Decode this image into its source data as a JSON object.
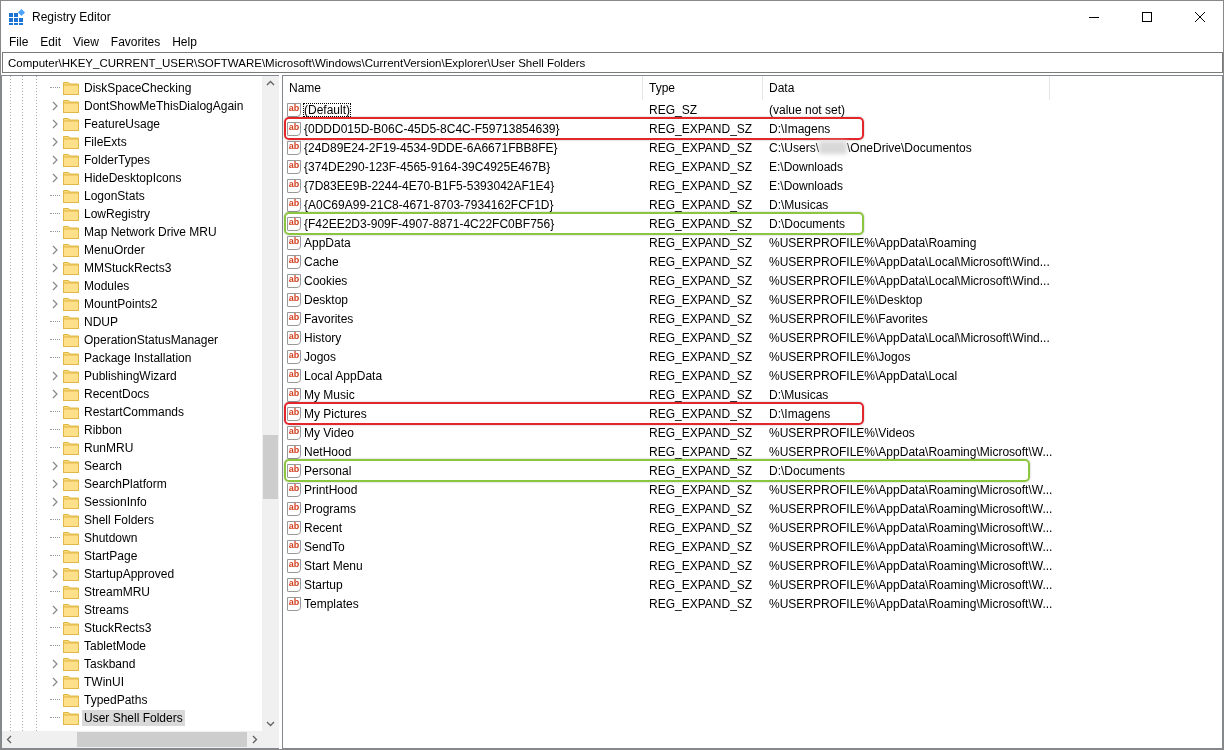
{
  "window": {
    "title": "Registry Editor"
  },
  "menu": [
    "File",
    "Edit",
    "View",
    "Favorites",
    "Help"
  ],
  "address": "Computer\\HKEY_CURRENT_USER\\SOFTWARE\\Microsoft\\Windows\\CurrentVersion\\Explorer\\User Shell Folders",
  "tree": {
    "items": [
      {
        "label": "DiskSpaceChecking",
        "expandable": false,
        "selected": false
      },
      {
        "label": "DontShowMeThisDialogAgain",
        "expandable": true,
        "selected": false
      },
      {
        "label": "FeatureUsage",
        "expandable": true,
        "selected": false
      },
      {
        "label": "FileExts",
        "expandable": true,
        "selected": false
      },
      {
        "label": "FolderTypes",
        "expandable": true,
        "selected": false
      },
      {
        "label": "HideDesktopIcons",
        "expandable": true,
        "selected": false
      },
      {
        "label": "LogonStats",
        "expandable": false,
        "selected": false
      },
      {
        "label": "LowRegistry",
        "expandable": false,
        "selected": false
      },
      {
        "label": "Map Network Drive MRU",
        "expandable": false,
        "selected": false
      },
      {
        "label": "MenuOrder",
        "expandable": true,
        "selected": false
      },
      {
        "label": "MMStuckRects3",
        "expandable": true,
        "selected": false
      },
      {
        "label": "Modules",
        "expandable": true,
        "selected": false
      },
      {
        "label": "MountPoints2",
        "expandable": true,
        "selected": false
      },
      {
        "label": "NDUP",
        "expandable": false,
        "selected": false
      },
      {
        "label": "OperationStatusManager",
        "expandable": false,
        "selected": false
      },
      {
        "label": "Package Installation",
        "expandable": false,
        "selected": false
      },
      {
        "label": "PublishingWizard",
        "expandable": true,
        "selected": false
      },
      {
        "label": "RecentDocs",
        "expandable": true,
        "selected": false
      },
      {
        "label": "RestartCommands",
        "expandable": false,
        "selected": false
      },
      {
        "label": "Ribbon",
        "expandable": false,
        "selected": false
      },
      {
        "label": "RunMRU",
        "expandable": false,
        "selected": false
      },
      {
        "label": "Search",
        "expandable": true,
        "selected": false
      },
      {
        "label": "SearchPlatform",
        "expandable": true,
        "selected": false
      },
      {
        "label": "SessionInfo",
        "expandable": true,
        "selected": false
      },
      {
        "label": "Shell Folders",
        "expandable": false,
        "selected": false
      },
      {
        "label": "Shutdown",
        "expandable": false,
        "selected": false
      },
      {
        "label": "StartPage",
        "expandable": false,
        "selected": false
      },
      {
        "label": "StartupApproved",
        "expandable": true,
        "selected": false
      },
      {
        "label": "StreamMRU",
        "expandable": false,
        "selected": false
      },
      {
        "label": "Streams",
        "expandable": true,
        "selected": false
      },
      {
        "label": "StuckRects3",
        "expandable": false,
        "selected": false
      },
      {
        "label": "TabletMode",
        "expandable": false,
        "selected": false
      },
      {
        "label": "Taskband",
        "expandable": true,
        "selected": false
      },
      {
        "label": "TWinUI",
        "expandable": true,
        "selected": false
      },
      {
        "label": "TypedPaths",
        "expandable": false,
        "selected": false
      },
      {
        "label": "User Shell Folders",
        "expandable": false,
        "selected": true
      }
    ]
  },
  "table": {
    "columns": [
      "Name",
      "Type",
      "Data"
    ],
    "rows": [
      {
        "icon": "ab",
        "name": "(Default)",
        "type": "REG_SZ",
        "data": "(value not set)",
        "focused": true
      },
      {
        "icon": "ab",
        "name": "{0DDD015D-B06C-45D5-8C4C-F59713854639}",
        "type": "REG_EXPAND_SZ",
        "data": "D:\\Imagens",
        "color": "#e3262b"
      },
      {
        "icon": "ab",
        "name": "{24D89E24-2F19-4534-9DDE-6A6671FBB8FE}",
        "type": "REG_EXPAND_SZ",
        "data": "C:\\Users\\",
        "redacted": true,
        "data_after": "\\OneDrive\\Documentos"
      },
      {
        "icon": "ab",
        "name": "{374DE290-123F-4565-9164-39C4925E467B}",
        "type": "REG_EXPAND_SZ",
        "data": "E:\\Downloads"
      },
      {
        "icon": "ab",
        "name": "{7D83EE9B-2244-4E70-B1F5-5393042AF1E4}",
        "type": "REG_EXPAND_SZ",
        "data": "E:\\Downloads"
      },
      {
        "icon": "ab",
        "name": "{A0C69A99-21C8-4671-8703-7934162FCF1D}",
        "type": "REG_EXPAND_SZ",
        "data": "D:\\Musicas"
      },
      {
        "icon": "ab",
        "name": "{F42EE2D3-909F-4907-8871-4C22FC0BF756}",
        "type": "REG_EXPAND_SZ",
        "data": "D:\\Documents",
        "color": "#8cc63f"
      },
      {
        "icon": "ab",
        "name": "AppData",
        "type": "REG_EXPAND_SZ",
        "data": "%USERPROFILE%\\AppData\\Roaming"
      },
      {
        "icon": "ab",
        "name": "Cache",
        "type": "REG_EXPAND_SZ",
        "data": "%USERPROFILE%\\AppData\\Local\\Microsoft\\Wind..."
      },
      {
        "icon": "ab",
        "name": "Cookies",
        "type": "REG_EXPAND_SZ",
        "data": "%USERPROFILE%\\AppData\\Local\\Microsoft\\Wind..."
      },
      {
        "icon": "ab",
        "name": "Desktop",
        "type": "REG_EXPAND_SZ",
        "data": "%USERPROFILE%\\Desktop"
      },
      {
        "icon": "ab",
        "name": "Favorites",
        "type": "REG_EXPAND_SZ",
        "data": "%USERPROFILE%\\Favorites"
      },
      {
        "icon": "ab",
        "name": "History",
        "type": "REG_EXPAND_SZ",
        "data": "%USERPROFILE%\\AppData\\Local\\Microsoft\\Wind..."
      },
      {
        "icon": "ab",
        "name": "Jogos",
        "type": "REG_EXPAND_SZ",
        "data": "%USERPROFILE%\\Jogos"
      },
      {
        "icon": "ab",
        "name": "Local AppData",
        "type": "REG_EXPAND_SZ",
        "data": "%USERPROFILE%\\AppData\\Local"
      },
      {
        "icon": "ab",
        "name": "My Music",
        "type": "REG_EXPAND_SZ",
        "data": "D:\\Musicas"
      },
      {
        "icon": "ab",
        "name": "My Pictures",
        "type": "REG_EXPAND_SZ",
        "data": "D:\\Imagens",
        "color": "#e3262b"
      },
      {
        "icon": "ab",
        "name": "My Video",
        "type": "REG_EXPAND_SZ",
        "data": "%USERPROFILE%\\Videos"
      },
      {
        "icon": "ab",
        "name": "NetHood",
        "type": "REG_EXPAND_SZ",
        "data": "%USERPROFILE%\\AppData\\Roaming\\Microsoft\\W..."
      },
      {
        "icon": "ab",
        "name": "Personal",
        "type": "REG_EXPAND_SZ",
        "data": "D:\\Documents",
        "color": "#8cc63f",
        "wide": true
      },
      {
        "icon": "ab",
        "name": "PrintHood",
        "type": "REG_EXPAND_SZ",
        "data": "%USERPROFILE%\\AppData\\Roaming\\Microsoft\\W..."
      },
      {
        "icon": "ab",
        "name": "Programs",
        "type": "REG_EXPAND_SZ",
        "data": "%USERPROFILE%\\AppData\\Roaming\\Microsoft\\W..."
      },
      {
        "icon": "ab",
        "name": "Recent",
        "type": "REG_EXPAND_SZ",
        "data": "%USERPROFILE%\\AppData\\Roaming\\Microsoft\\W..."
      },
      {
        "icon": "ab",
        "name": "SendTo",
        "type": "REG_EXPAND_SZ",
        "data": "%USERPROFILE%\\AppData\\Roaming\\Microsoft\\W..."
      },
      {
        "icon": "ab",
        "name": "Start Menu",
        "type": "REG_EXPAND_SZ",
        "data": "%USERPROFILE%\\AppData\\Roaming\\Microsoft\\W..."
      },
      {
        "icon": "ab",
        "name": "Startup",
        "type": "REG_EXPAND_SZ",
        "data": "%USERPROFILE%\\AppData\\Roaming\\Microsoft\\W..."
      },
      {
        "icon": "ab",
        "name": "Templates",
        "type": "REG_EXPAND_SZ",
        "data": "%USERPROFILE%\\AppData\\Roaming\\Microsoft\\W..."
      }
    ]
  }
}
